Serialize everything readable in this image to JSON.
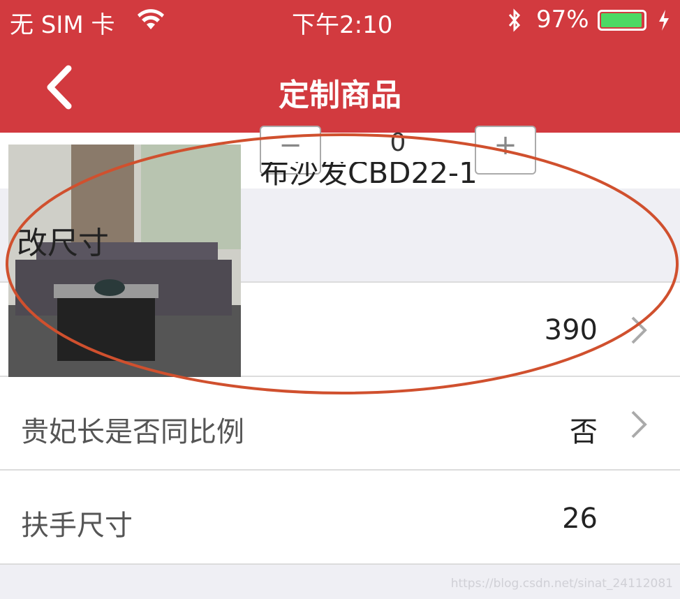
{
  "status_bar": {
    "carrier": "无 SIM 卡",
    "time": "下午2:10",
    "battery": "97%",
    "battery_level": 0.97,
    "icons": [
      "wifi-icon",
      "bluetooth-icon",
      "battery-icon",
      "charging-icon"
    ]
  },
  "nav": {
    "title": "定制商品",
    "back_icon": "chevron-left-icon"
  },
  "product": {
    "name": "布沙发CBD22-1",
    "quantity": "0",
    "minus": "−",
    "plus": "+"
  },
  "overlapping_label": "改尺寸",
  "rows": [
    {
      "label": "",
      "value": "390"
    },
    {
      "label": "贵妃长是否同比例",
      "value": "否"
    },
    {
      "label": "扶手尺寸",
      "value": "26"
    }
  ],
  "annotation_color": "#d0502e",
  "accent": "#d23a3f",
  "watermark": "https://blog.csdn.net/sinat_24112081"
}
